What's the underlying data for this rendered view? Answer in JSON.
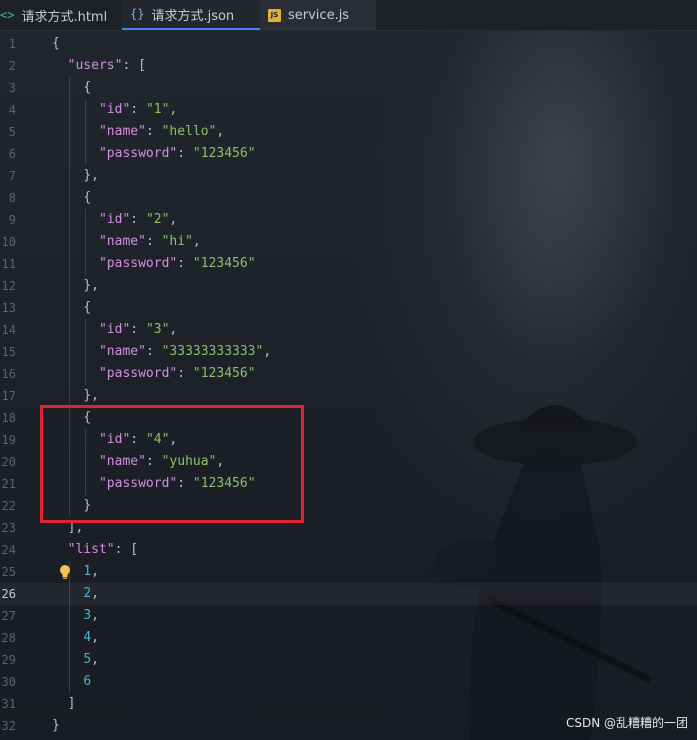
{
  "tabs": [
    {
      "label": "请求方式.html",
      "icon": "html-file-icon",
      "glyph": "<>"
    },
    {
      "label": "请求方式.json",
      "icon": "json-file-icon",
      "glyph": "{}",
      "active": true
    },
    {
      "label": "service.js",
      "icon": "js-file-icon",
      "glyph": "JS"
    }
  ],
  "editor": {
    "current_line": 26,
    "lines": [
      {
        "no": "1"
      },
      {
        "no": "2"
      },
      {
        "no": "3"
      },
      {
        "no": "4"
      },
      {
        "no": "5"
      },
      {
        "no": "6"
      },
      {
        "no": "7"
      },
      {
        "no": "8"
      },
      {
        "no": "9"
      },
      {
        "no": "10"
      },
      {
        "no": "11"
      },
      {
        "no": "12"
      },
      {
        "no": "13"
      },
      {
        "no": "14"
      },
      {
        "no": "15"
      },
      {
        "no": "16"
      },
      {
        "no": "17"
      },
      {
        "no": "18"
      },
      {
        "no": "19"
      },
      {
        "no": "20"
      },
      {
        "no": "21"
      },
      {
        "no": "22"
      },
      {
        "no": "23"
      },
      {
        "no": "24"
      },
      {
        "no": "25"
      },
      {
        "no": "26"
      },
      {
        "no": "27"
      },
      {
        "no": "28"
      },
      {
        "no": "29"
      },
      {
        "no": "30"
      },
      {
        "no": "31"
      },
      {
        "no": "32"
      }
    ],
    "json": {
      "users_key": "\"users\"",
      "users": [
        {
          "id": "\"1\"",
          "name": "\"hello\"",
          "password": "\"123456\""
        },
        {
          "id": "\"2\"",
          "name": "\"hi\"",
          "password": "\"123456\""
        },
        {
          "id": "\"3\"",
          "name": "\"33333333333\"",
          "password": "\"123456\""
        },
        {
          "id": "\"4\"",
          "name": "\"yuhua\"",
          "password": "\"123456\""
        }
      ],
      "id_key": "\"id\"",
      "name_key": "\"name\"",
      "password_key": "\"password\"",
      "list_key": "\"list\"",
      "list": [
        "1",
        "2",
        "3",
        "4",
        "5",
        "6"
      ]
    }
  },
  "highlight_color": "#e1232f",
  "watermark": "CSDN @乱糟糟的一团"
}
